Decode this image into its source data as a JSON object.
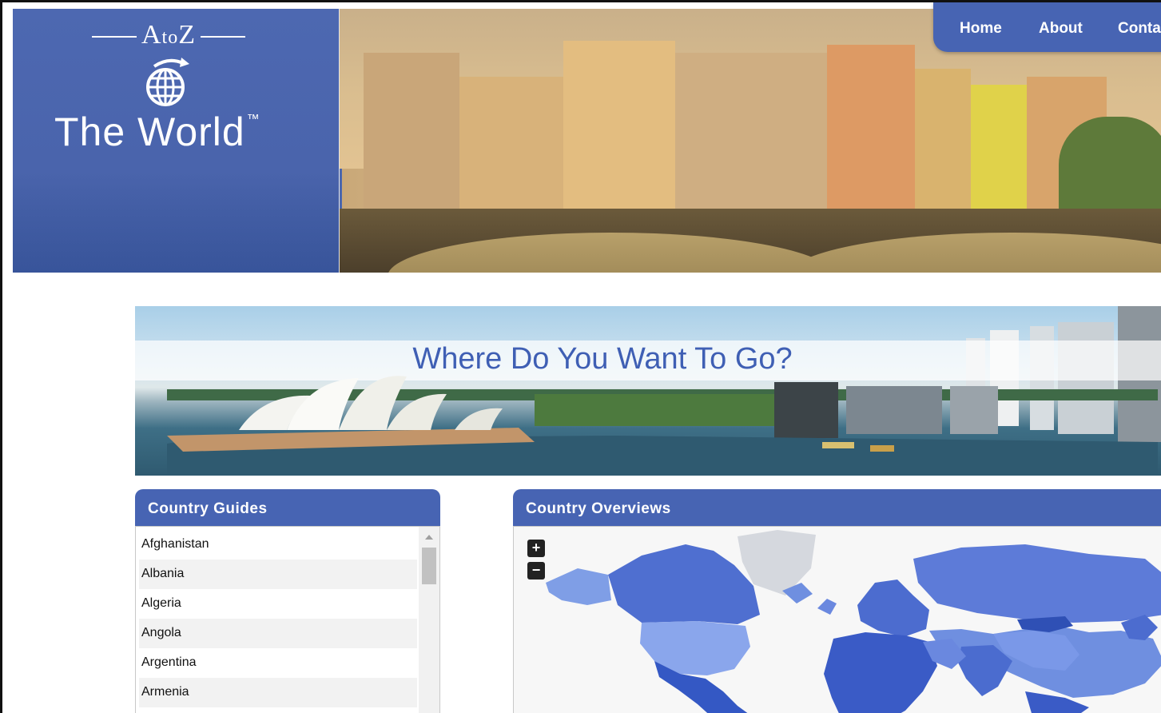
{
  "logo": {
    "top_text": "AtoZ",
    "top_small": "to",
    "bottom_text": "The World",
    "trademark": "™"
  },
  "nav": {
    "items": [
      "Home",
      "About",
      "Conta"
    ]
  },
  "hero": {
    "title": "Where Do You Want To Go?"
  },
  "country_guides": {
    "title": "Country Guides",
    "items": [
      "Afghanistan",
      "Albania",
      "Algeria",
      "Angola",
      "Argentina",
      "Armenia"
    ]
  },
  "country_overviews": {
    "title": "Country Overviews",
    "zoom_in": "+",
    "zoom_out": "−"
  },
  "colors": {
    "brand_blue": "#4764b3",
    "title_blue": "#3f5fb4",
    "map_country": "#6f8fe0",
    "map_highlight": "#2f50b5",
    "map_greenland": "#d5d8de"
  }
}
